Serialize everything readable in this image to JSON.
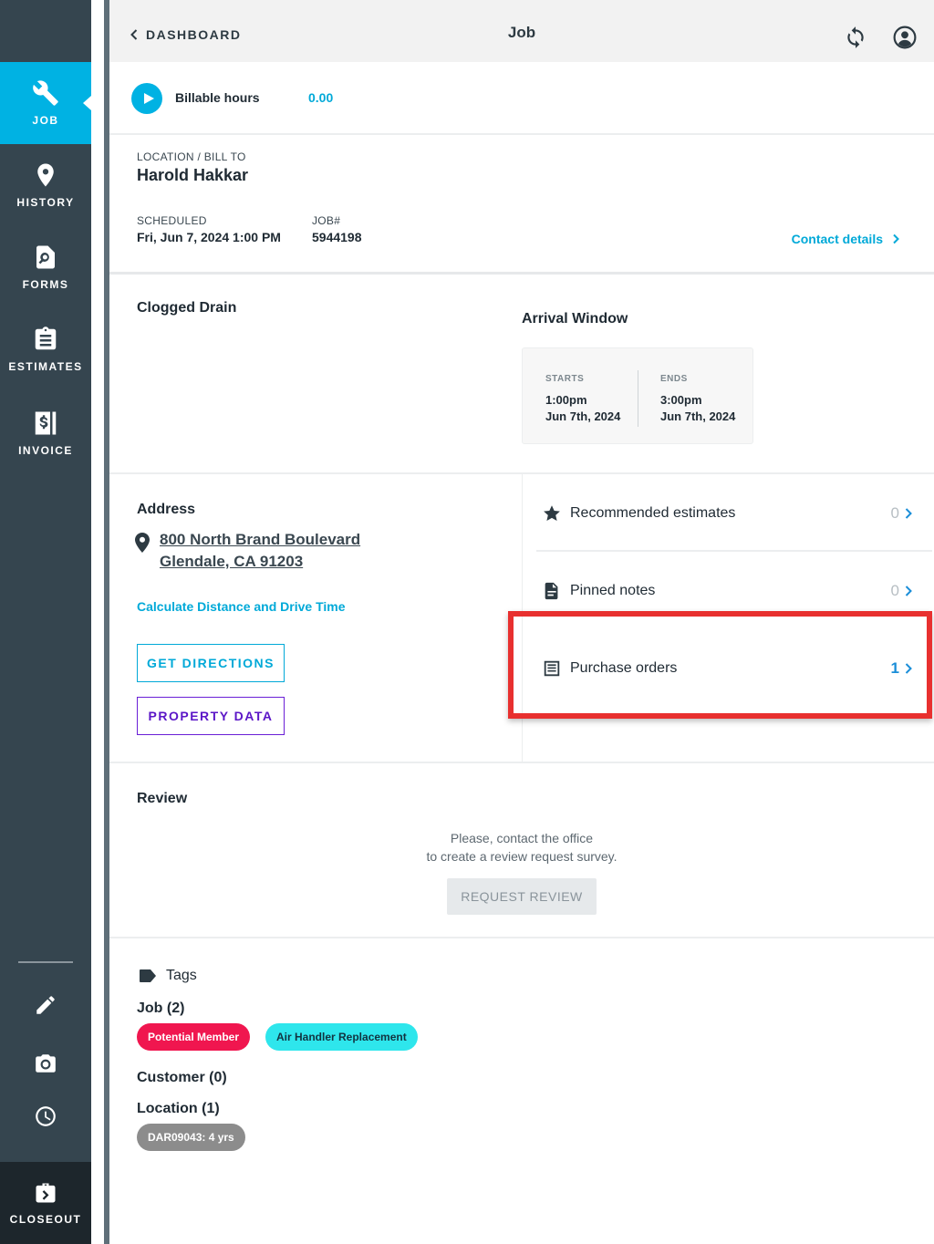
{
  "sidebar": {
    "items": [
      {
        "label": "JOB",
        "icon": "wrench-icon"
      },
      {
        "label": "HISTORY",
        "icon": "map-pin-icon"
      },
      {
        "label": "FORMS",
        "icon": "form-search-icon"
      },
      {
        "label": "ESTIMATES",
        "icon": "clipboard-icon"
      },
      {
        "label": "INVOICE",
        "icon": "invoice-dollar-icon"
      }
    ],
    "tools": [
      "pencil-icon",
      "camera-icon",
      "clock-icon"
    ],
    "closeout_label": "CLOSEOUT"
  },
  "header": {
    "back_label": "DASHBOARD",
    "title": "Job"
  },
  "billable": {
    "label": "Billable hours",
    "value": "0.00"
  },
  "customer": {
    "location_caption": "LOCATION / BILL TO",
    "name": "Harold Hakkar",
    "scheduled_caption": "SCHEDULED",
    "scheduled_value": "Fri, Jun 7, 2024 1:00 PM",
    "job_caption": "JOB#",
    "job_value": "5944198",
    "contact_link": "Contact details"
  },
  "job": {
    "title": "Clogged Drain",
    "arrival_title": "Arrival Window",
    "starts_caption": "STARTS",
    "starts_time": "1:00pm",
    "starts_date": "Jun 7th, 2024",
    "ends_caption": "ENDS",
    "ends_time": "3:00pm",
    "ends_date": "Jun 7th, 2024"
  },
  "address": {
    "title": "Address",
    "line1": "800 North Brand Boulevard",
    "line2": "Glendale, CA 91203",
    "calc_link": "Calculate Distance and Drive Time",
    "directions_button": "GET DIRECTIONS",
    "property_button": "PROPERTY DATA"
  },
  "lists": [
    {
      "label": "Recommended estimates",
      "count": "0"
    },
    {
      "label": "Pinned notes",
      "count": "0"
    },
    {
      "label": "Purchase orders",
      "count": "1"
    }
  ],
  "review": {
    "title": "Review",
    "message_line1": "Please, contact the office",
    "message_line2": "to create a review request survey.",
    "button": "REQUEST REVIEW"
  },
  "tags": {
    "title": "Tags",
    "job_title": "Job (2)",
    "job_tags": [
      "Potential Member",
      "Air Handler Replacement"
    ],
    "customer_title": "Customer (0)",
    "location_title": "Location (1)",
    "location_tags": [
      "DAR09043: 4 yrs"
    ]
  },
  "colors": {
    "accent": "#00b2e3",
    "sidebar": "#35454f",
    "potential_member": "#f0164f",
    "air_handler": "#2ee6ec",
    "location_tag": "#8c8c8c",
    "highlight": "#e8302f"
  }
}
